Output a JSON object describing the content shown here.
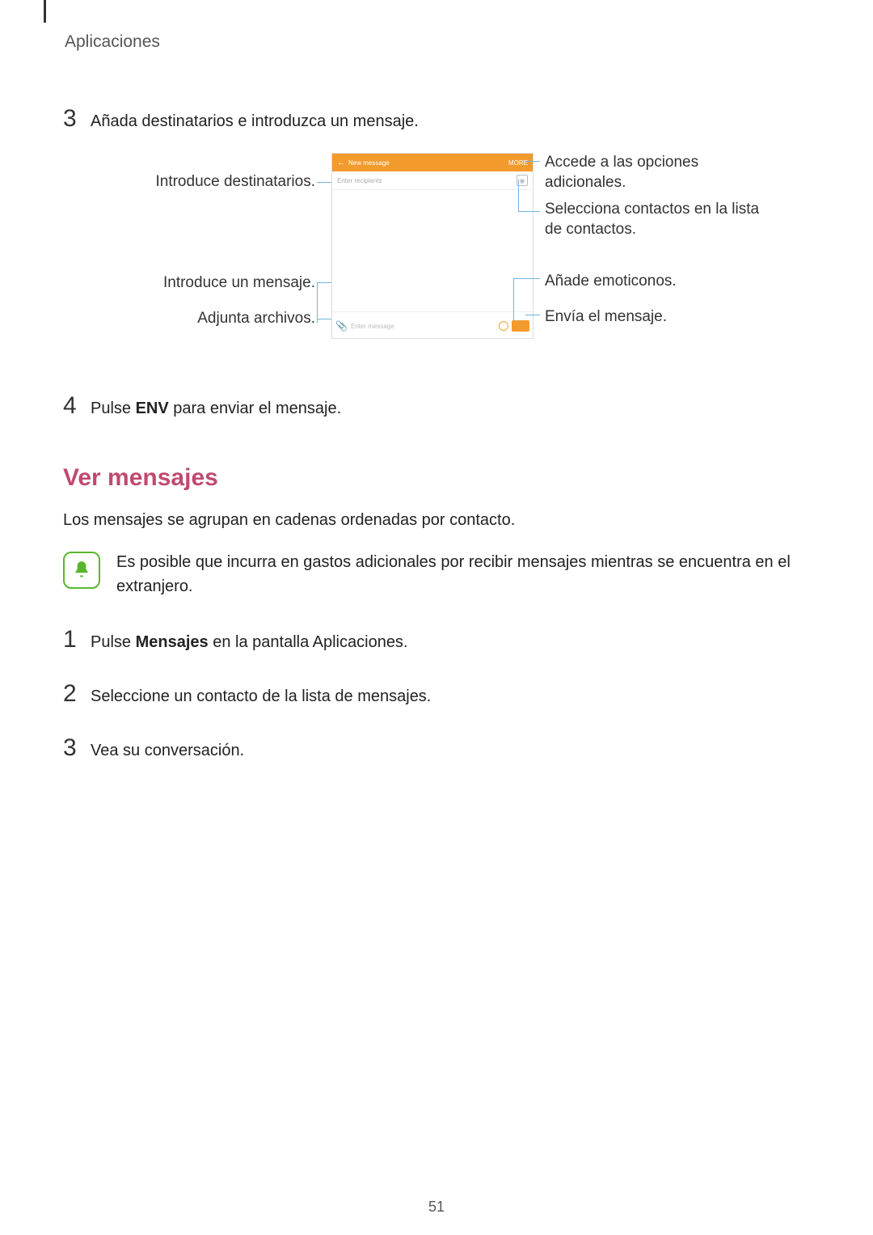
{
  "section_label": "Aplicaciones",
  "step3": {
    "num": "3",
    "text": "Añada destinatarios e introduzca un mensaje."
  },
  "step4": {
    "num": "4",
    "text_before": "Pulse ",
    "bold": "ENV",
    "text_after": " para enviar el mensaje."
  },
  "diagram": {
    "left": {
      "recipients": "Introduce destinatarios.",
      "message": "Introduce un mensaje.",
      "attach": "Adjunta archivos."
    },
    "right": {
      "more": "Accede a las opciones adicionales.",
      "contacts": "Selecciona contactos en la lista de contactos.",
      "emoji": "Añade emoticonos.",
      "send": "Envía el mensaje."
    },
    "phone": {
      "title": "New message",
      "more": "MORE",
      "recipient_placeholder": "Enter recipients",
      "message_placeholder": "Enter message"
    }
  },
  "heading_view": "Ver mensajes",
  "para_view": "Los mensajes se agrupan en cadenas ordenadas por contacto.",
  "note": "Es posible que incurra en gastos adicionales por recibir mensajes mientras se encuentra en el extranjero.",
  "view_steps": {
    "s1": {
      "num": "1",
      "before": "Pulse ",
      "bold": "Mensajes",
      "after": " en la pantalla Aplicaciones."
    },
    "s2": {
      "num": "2",
      "text": "Seleccione un contacto de la lista de mensajes."
    },
    "s3": {
      "num": "3",
      "text": "Vea su conversación."
    }
  },
  "page_number": "51"
}
